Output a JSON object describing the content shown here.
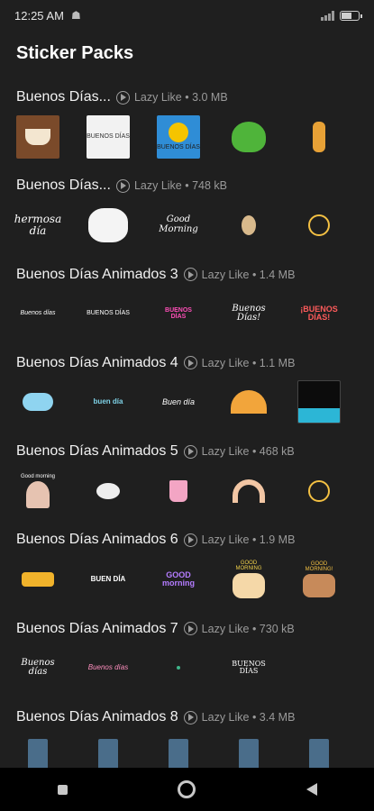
{
  "status": {
    "time": "12:25 AM",
    "battery": "53",
    "battery_level": 0.53
  },
  "header": {
    "title": "Sticker Packs"
  },
  "packs": [
    {
      "title": "Buenos Días...",
      "meta": "Lazy Like • 3.0 MB"
    },
    {
      "title": "Buenos Días...",
      "meta": "Lazy Like • 748 kB"
    },
    {
      "title": "Buenos Días Animados 3",
      "meta": "Lazy Like • 1.4 MB"
    },
    {
      "title": "Buenos Días Animados 4",
      "meta": "Lazy Like • 1.1 MB"
    },
    {
      "title": "Buenos Días Animados 5",
      "meta": "Lazy Like • 468 kB"
    },
    {
      "title": "Buenos Días Animados 6",
      "meta": "Lazy Like • 1.9 MB"
    },
    {
      "title": "Buenos Días Animados 7",
      "meta": "Lazy Like • 730 kB"
    },
    {
      "title": "Buenos Días Animados 8",
      "meta": "Lazy Like • 3.4 MB"
    }
  ],
  "sticker_text": {
    "p1s2": "BUENOS DÍAS",
    "p1s3": "BUENOS DÍAS",
    "p2s1": "hermosa día",
    "p2s3": "Good Morning",
    "p3s1": "Buenos días",
    "p3s2": "BUENOS DÍAS",
    "p3s3": "BUENOS DÍAS",
    "p3s4": "Buenos Días!",
    "p3s5": "¡BUENOS DÍAS!",
    "p4s2": "buen día",
    "p4s3": "Buen día",
    "p5s1": "Good morning",
    "p6s2": "BUEN DÍA",
    "p6s3": "GOOD morning",
    "p6s4": "GOOD MORNING",
    "p6s5": "GOOD MORNING!",
    "p7s1": "Buenos días",
    "p7s2": "Buenos días",
    "p7s4": "BUENOS DÍAS"
  }
}
